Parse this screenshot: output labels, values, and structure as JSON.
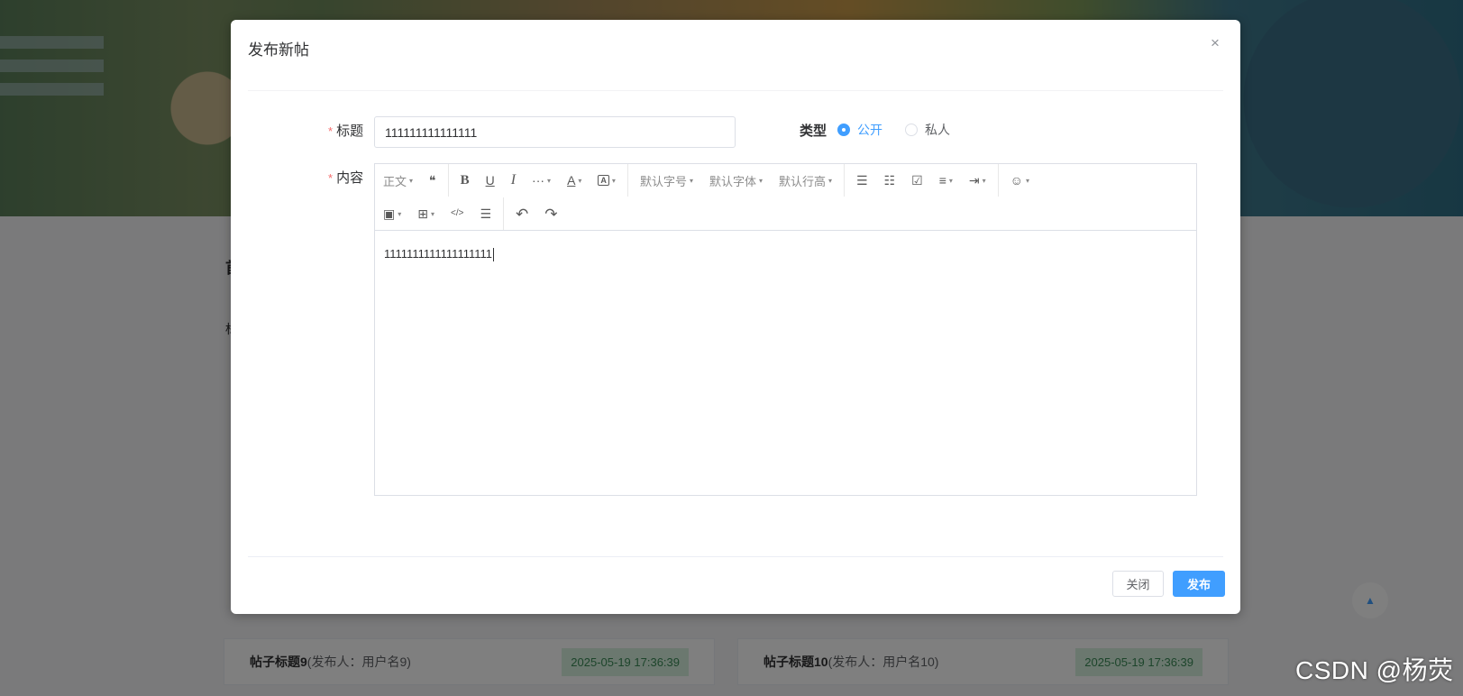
{
  "dialog": {
    "title": "发布新帖",
    "close_icon": "×"
  },
  "form": {
    "title_label": "标题",
    "title_value": "111111111111111",
    "content_label": "内容",
    "required_mark": "*",
    "type_label": "类型",
    "type_options": [
      {
        "label": "公开",
        "checked": true
      },
      {
        "label": "私人",
        "checked": false
      }
    ]
  },
  "editor": {
    "toolbar": {
      "paragraph": "正文",
      "quote": "❝",
      "bold": "B",
      "underline": "U",
      "italic": "I",
      "more": "···",
      "font_color": "A",
      "bg_color": "A",
      "font_size": "默认字号",
      "font_family": "默认字体",
      "line_height": "默认行高",
      "bullet_list": "☰",
      "numbered_list": "☷",
      "todo": "☑",
      "justify": "≡",
      "indent": "⇥",
      "emotion": "☺",
      "image": "▣",
      "table": "⊞",
      "code": "</>",
      "divider": "☰",
      "undo": "↶",
      "redo": "↷",
      "caret": "▾"
    },
    "content": "1111111111111111111"
  },
  "buttons": {
    "close": "关闭",
    "publish": "发布"
  },
  "background": {
    "section_title": "首",
    "section_label": "标",
    "posts": [
      {
        "title": "帖子标题9",
        "meta": "(发布人：用户名9)",
        "date": "2025-05-19 17:36:39"
      },
      {
        "title": "帖子标题10",
        "meta": "(发布人：用户名10)",
        "date": "2025-05-19 17:36:39"
      }
    ],
    "back_to_top": "▲"
  },
  "watermark": "CSDN @杨荧",
  "colors": {
    "primary": "#409eff",
    "required": "#f56c6c",
    "date_bg": "#d6f0de",
    "date_text": "#3a8a57"
  }
}
